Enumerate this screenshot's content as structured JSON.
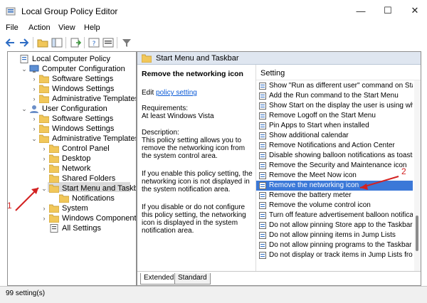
{
  "window": {
    "title": "Local Group Policy Editor"
  },
  "window_controls": {
    "minimize": "—",
    "maximize": "☐",
    "close": "✕"
  },
  "menu": [
    "File",
    "Action",
    "View",
    "Help"
  ],
  "tree": {
    "items": [
      {
        "label": "Local Computer Policy",
        "expander": ""
      },
      {
        "label": "Computer Configuration",
        "expander": "⌄"
      },
      {
        "label": "Software Settings",
        "expander": "›"
      },
      {
        "label": "Windows Settings",
        "expander": "›"
      },
      {
        "label": "Administrative Templates",
        "expander": "›"
      },
      {
        "label": "User Configuration",
        "expander": "⌄"
      },
      {
        "label": "Software Settings",
        "expander": "›"
      },
      {
        "label": "Windows Settings",
        "expander": "›"
      },
      {
        "label": "Administrative Templates",
        "expander": "⌄"
      },
      {
        "label": "Control Panel",
        "expander": "›"
      },
      {
        "label": "Desktop",
        "expander": "›"
      },
      {
        "label": "Network",
        "expander": "›"
      },
      {
        "label": "Shared Folders",
        "expander": ""
      },
      {
        "label": "Start Menu and Taskbar",
        "expander": "⌄"
      },
      {
        "label": "Notifications",
        "expander": ""
      },
      {
        "label": "System",
        "expander": "›"
      },
      {
        "label": "Windows Components",
        "expander": "›"
      },
      {
        "label": "All Settings",
        "expander": ""
      }
    ]
  },
  "pane": {
    "header": "Start Menu and Taskbar",
    "description": {
      "title": "Remove the networking icon",
      "edit_prefix": "Edit ",
      "edit_link": "policy setting",
      "requirements_label": "Requirements:",
      "requirements_value": "At least Windows Vista",
      "description_label": "Description:",
      "p1": "This policy setting allows you to remove the networking icon from the system control area.",
      "p2": "If you enable this policy setting, the networking icon is not displayed in the system notification area.",
      "p3": "If you disable or do not configure this policy setting, the networking icon is displayed in the system notification area."
    },
    "settings": {
      "header": "Setting",
      "items": [
        "Show \"Run as different user\" command on Start",
        "Add the Run command to the Start Menu",
        "Show Start on the display the user is using when t",
        "Remove Logoff on the Start Menu",
        "Pin Apps to Start when installed",
        "Show additional calendar",
        "Remove Notifications and Action Center",
        "Disable showing balloon notifications as toasts.",
        "Remove the Security and Maintenance icon",
        "Remove the Meet Now icon",
        "Remove the networking icon",
        "Remove the battery meter",
        "Remove the volume control icon",
        "Turn off feature advertisement balloon notifications",
        "Do not allow pinning Store app to the Taskbar",
        "Do not allow pinning items in Jump Lists",
        "Do not allow pinning programs to the Taskbar",
        "Do not display or track items in Jump Lists from re"
      ],
      "selected_index": 10
    },
    "tabs": [
      "Extended",
      "Standard"
    ]
  },
  "status": "99 setting(s)",
  "annotations": [
    "1",
    "2"
  ],
  "colors": {
    "selection": "#3b78d8",
    "annotation": "#d32222",
    "link": "#0a5ad6",
    "folder": "#f1c75a"
  }
}
